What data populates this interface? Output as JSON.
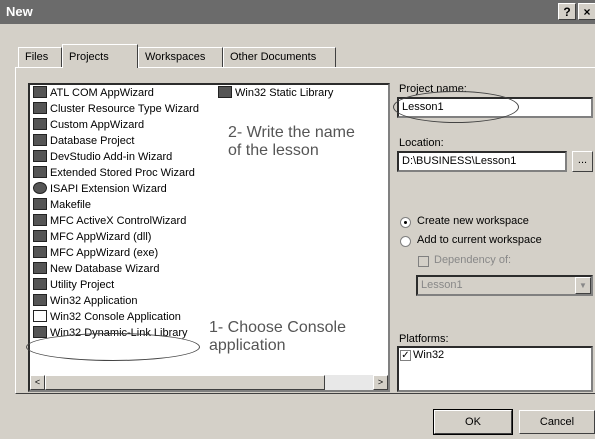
{
  "window": {
    "title": "New",
    "help_label": "?",
    "close_label": "×"
  },
  "tabs": [
    {
      "label": "Files"
    },
    {
      "label": "Projects"
    },
    {
      "label": "Workspaces"
    },
    {
      "label": "Other Documents"
    }
  ],
  "projects_left": [
    "ATL COM AppWizard",
    "Cluster Resource Type Wizard",
    "Custom AppWizard",
    "Database Project",
    "DevStudio Add-in Wizard",
    "Extended Stored Proc Wizard",
    "ISAPI Extension Wizard",
    "Makefile",
    "MFC ActiveX ControlWizard",
    "MFC AppWizard (dll)",
    "MFC AppWizard (exe)",
    "New Database Wizard",
    "Utility Project",
    "Win32 Application",
    "Win32 Console Application",
    "Win32 Dynamic-Link Library"
  ],
  "projects_right": [
    "Win32 Static Library"
  ],
  "annotations": {
    "step1_line1": "1- Choose Console",
    "step1_line2": "application",
    "step2_line1": "2- Write the name",
    "step2_line2": "of the lesson"
  },
  "form": {
    "project_name_label": "Project name:",
    "project_name_value": "Lesson1",
    "location_label": "Location:",
    "location_value": "D:\\BUSINESS\\Lesson1",
    "browse_label": "...",
    "radio_create_label": "Create new workspace",
    "radio_add_label": "Add to current workspace",
    "dependency_label": "Dependency of:",
    "dependency_value": "Lesson1",
    "platforms_label": "Platforms:",
    "platform_win32": "Win32"
  },
  "buttons": {
    "ok": "OK",
    "cancel": "Cancel"
  },
  "scroll": {
    "left": "<",
    "right": ">",
    "down": "▼"
  }
}
